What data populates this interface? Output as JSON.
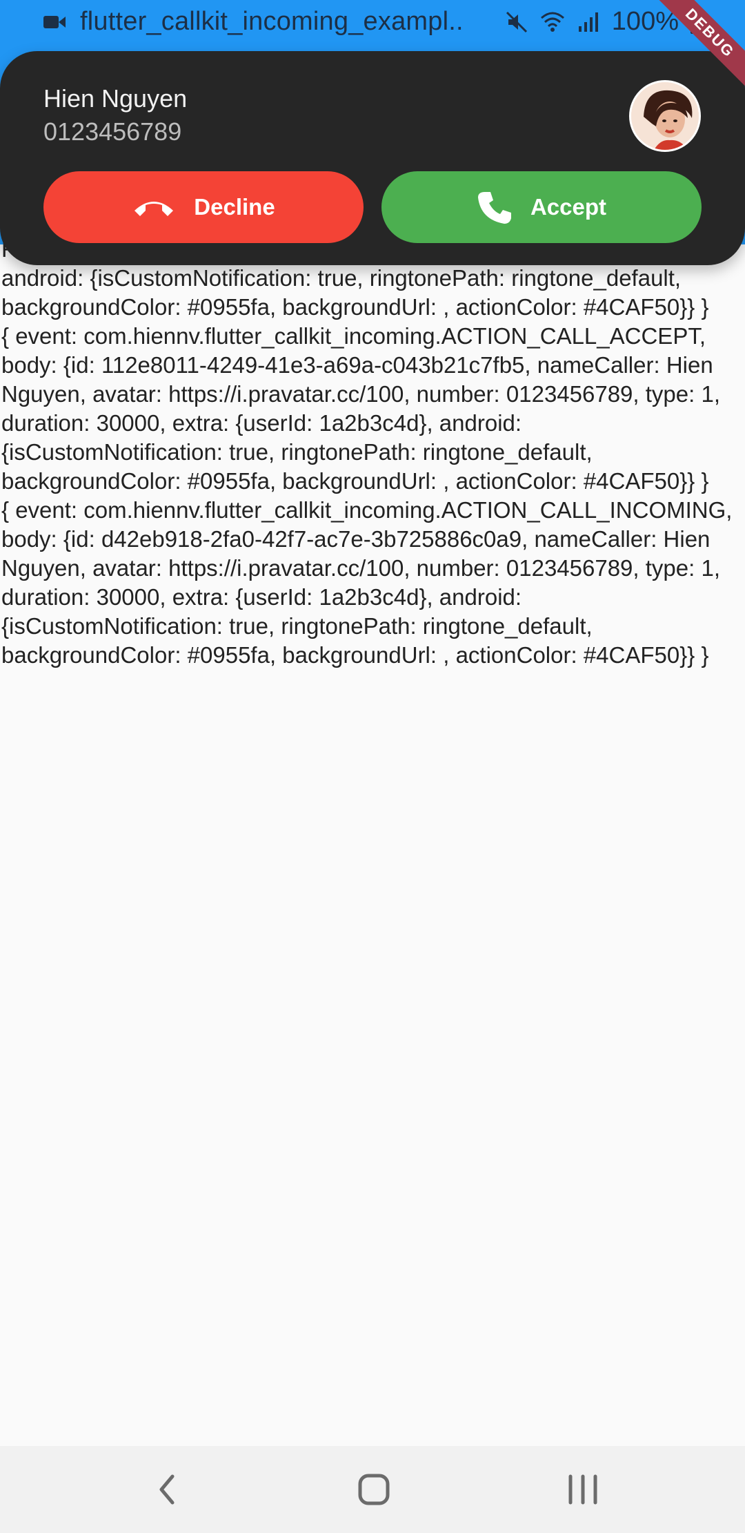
{
  "status_bar": {
    "title": "flutter_callkit_incoming_exampl..",
    "battery": "100%",
    "icons": [
      "video-icon",
      "mute-icon",
      "wifi-icon",
      "signal-icon",
      "battery-icon"
    ]
  },
  "debug_banner": "DEBUG",
  "call": {
    "name": "Hien Nguyen",
    "number": "0123456789",
    "decline_label": "Decline",
    "accept_label": "Accept",
    "colors": {
      "card": "#262626",
      "decline": "#f44336",
      "accept": "#4caf50"
    }
  },
  "log": {
    "entries": [
      "F… 0123456789, type: 1, duration: 30000, extra: {userId: 1a2b3c4d}, android: {isCustomNotification: true, ringtonePath: ringtone_default, backgroundColor: #0955fa, backgroundUrl: , actionColor: #4CAF50}} }",
      "{ event: com.hiennv.flutter_callkit_incoming.ACTION_CALL_ACCEPT, body: {id: 112e8011-4249-41e3-a69a-c043b21c7fb5, nameCaller: Hien Nguyen, avatar: https://i.pravatar.cc/100, number: 0123456789, type: 1, duration: 30000, extra: {userId: 1a2b3c4d}, android: {isCustomNotification: true, ringtonePath: ringtone_default, backgroundColor: #0955fa, backgroundUrl: , actionColor: #4CAF50}} }",
      "{ event: com.hiennv.flutter_callkit_incoming.ACTION_CALL_INCOMING, body: {id: d42eb918-2fa0-42f7-ac7e-3b725886c0a9, nameCaller: Hien Nguyen, avatar: https://i.pravatar.cc/100, number: 0123456789, type: 1, duration: 30000, extra: {userId: 1a2b3c4d}, android: {isCustomNotification: true, ringtonePath: ringtone_default, backgroundColor: #0955fa, backgroundUrl: , actionColor: #4CAF50}} }"
    ]
  },
  "nav": {
    "icons": [
      "back-icon",
      "home-icon",
      "recents-icon"
    ]
  }
}
